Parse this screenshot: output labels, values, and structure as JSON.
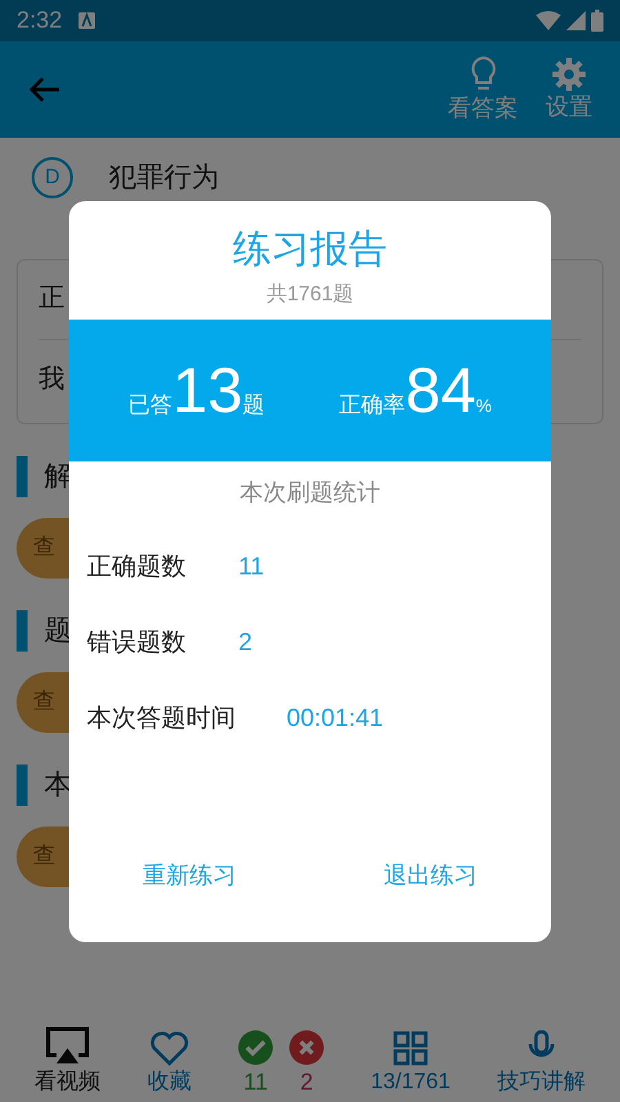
{
  "status_bar": {
    "time": "2:32"
  },
  "app_bar": {
    "actions": [
      {
        "kind": "bulb",
        "label": "看答案"
      },
      {
        "kind": "gear",
        "label": "设置"
      }
    ]
  },
  "question": {
    "option_letter": "D",
    "option_text": "犯罪行为"
  },
  "card_rows": [
    "正",
    "我"
  ],
  "sections": [
    {
      "title": "解",
      "button": "查"
    },
    {
      "title": "题",
      "button": "查"
    },
    {
      "title": "本",
      "button": "查"
    }
  ],
  "dialog": {
    "title": "练习报告",
    "subtitle": "共1761题",
    "answered": {
      "prefix": "已答",
      "value": "13",
      "suffix": "题"
    },
    "accuracy": {
      "prefix": "正确率",
      "value": "84",
      "suffix": "%"
    },
    "stats_heading": "本次刷题统计",
    "stats": [
      {
        "label": "正确题数",
        "value": "11"
      },
      {
        "label": "错误题数",
        "value": "2"
      },
      {
        "label": "本次答题时间",
        "value": "00:01:41"
      }
    ],
    "buttons": [
      "重新练习",
      "退出练习"
    ]
  },
  "bottom_bar": [
    {
      "kind": "video",
      "label": "看视频"
    },
    {
      "kind": "heart",
      "label": "收藏"
    },
    {
      "kind": "score",
      "correct": "11",
      "wrong": "2"
    },
    {
      "kind": "grid",
      "label": "13/1761"
    },
    {
      "kind": "tips",
      "label": "技巧讲解"
    }
  ]
}
